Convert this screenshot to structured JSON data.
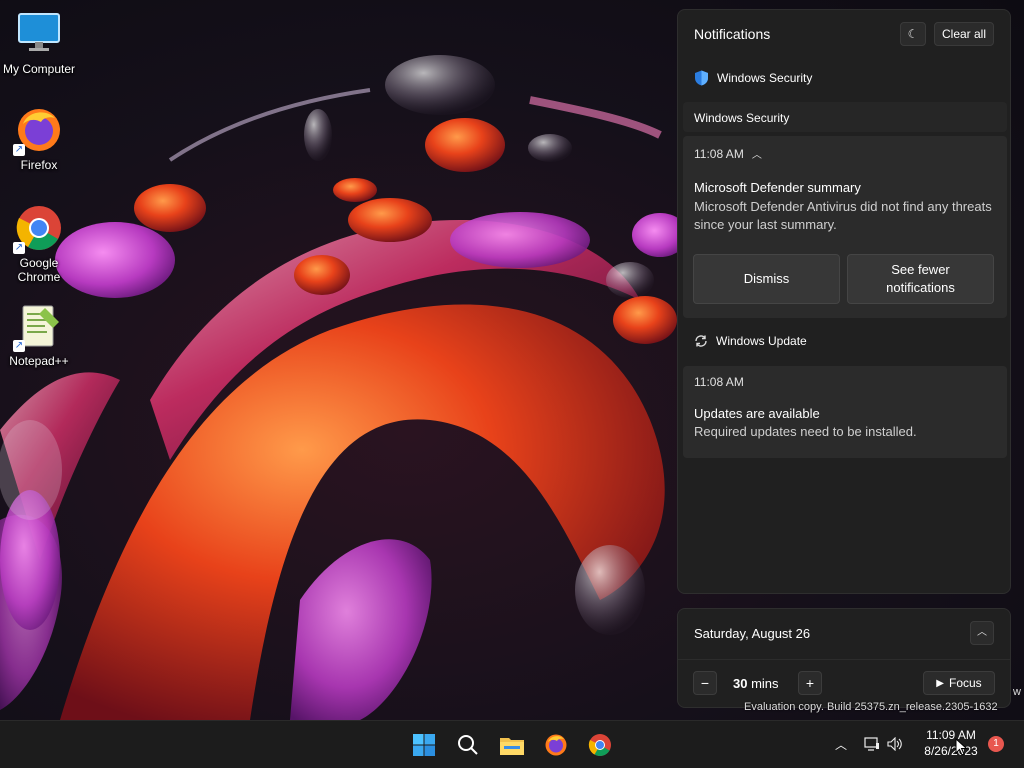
{
  "desktop": {
    "icons": [
      {
        "label": "My Computer"
      },
      {
        "label": "Firefox"
      },
      {
        "label": "Google Chrome"
      },
      {
        "label": "Notepad++"
      }
    ]
  },
  "notifications": {
    "title": "Notifications",
    "clear_all_label": "Clear all",
    "groups": [
      {
        "app": "Windows Security",
        "card_title": "Windows Security",
        "time": "11:08 AM",
        "title": "Microsoft Defender summary",
        "body": "Microsoft Defender Antivirus did not find any threats since your last summary.",
        "actions": [
          "Dismiss",
          "See fewer notifications"
        ]
      },
      {
        "app": "Windows Update",
        "time": "11:08 AM",
        "title": "Updates are available",
        "body": "Required updates need to be installed."
      }
    ]
  },
  "calendar": {
    "date": "Saturday, August 26",
    "focus_value": "30",
    "focus_unit": "mins",
    "focus_label": "Focus"
  },
  "watermark": {
    "line": "Evaluation copy. Build 25375.zn_release.2305‑1632",
    "trailing": "w"
  },
  "taskbar": {
    "apps": [
      "start-icon",
      "search-icon",
      "file-explorer-icon",
      "firefox-icon",
      "chrome-icon"
    ],
    "clock_time": "11:09 AM",
    "clock_date": "8/26/2023",
    "notification_count": "1"
  },
  "colors": {
    "panel_bg": "#202020",
    "card_bg": "#2b2b2b",
    "accent_blue": "#4aa3f0",
    "badge_red": "#e8574f"
  }
}
